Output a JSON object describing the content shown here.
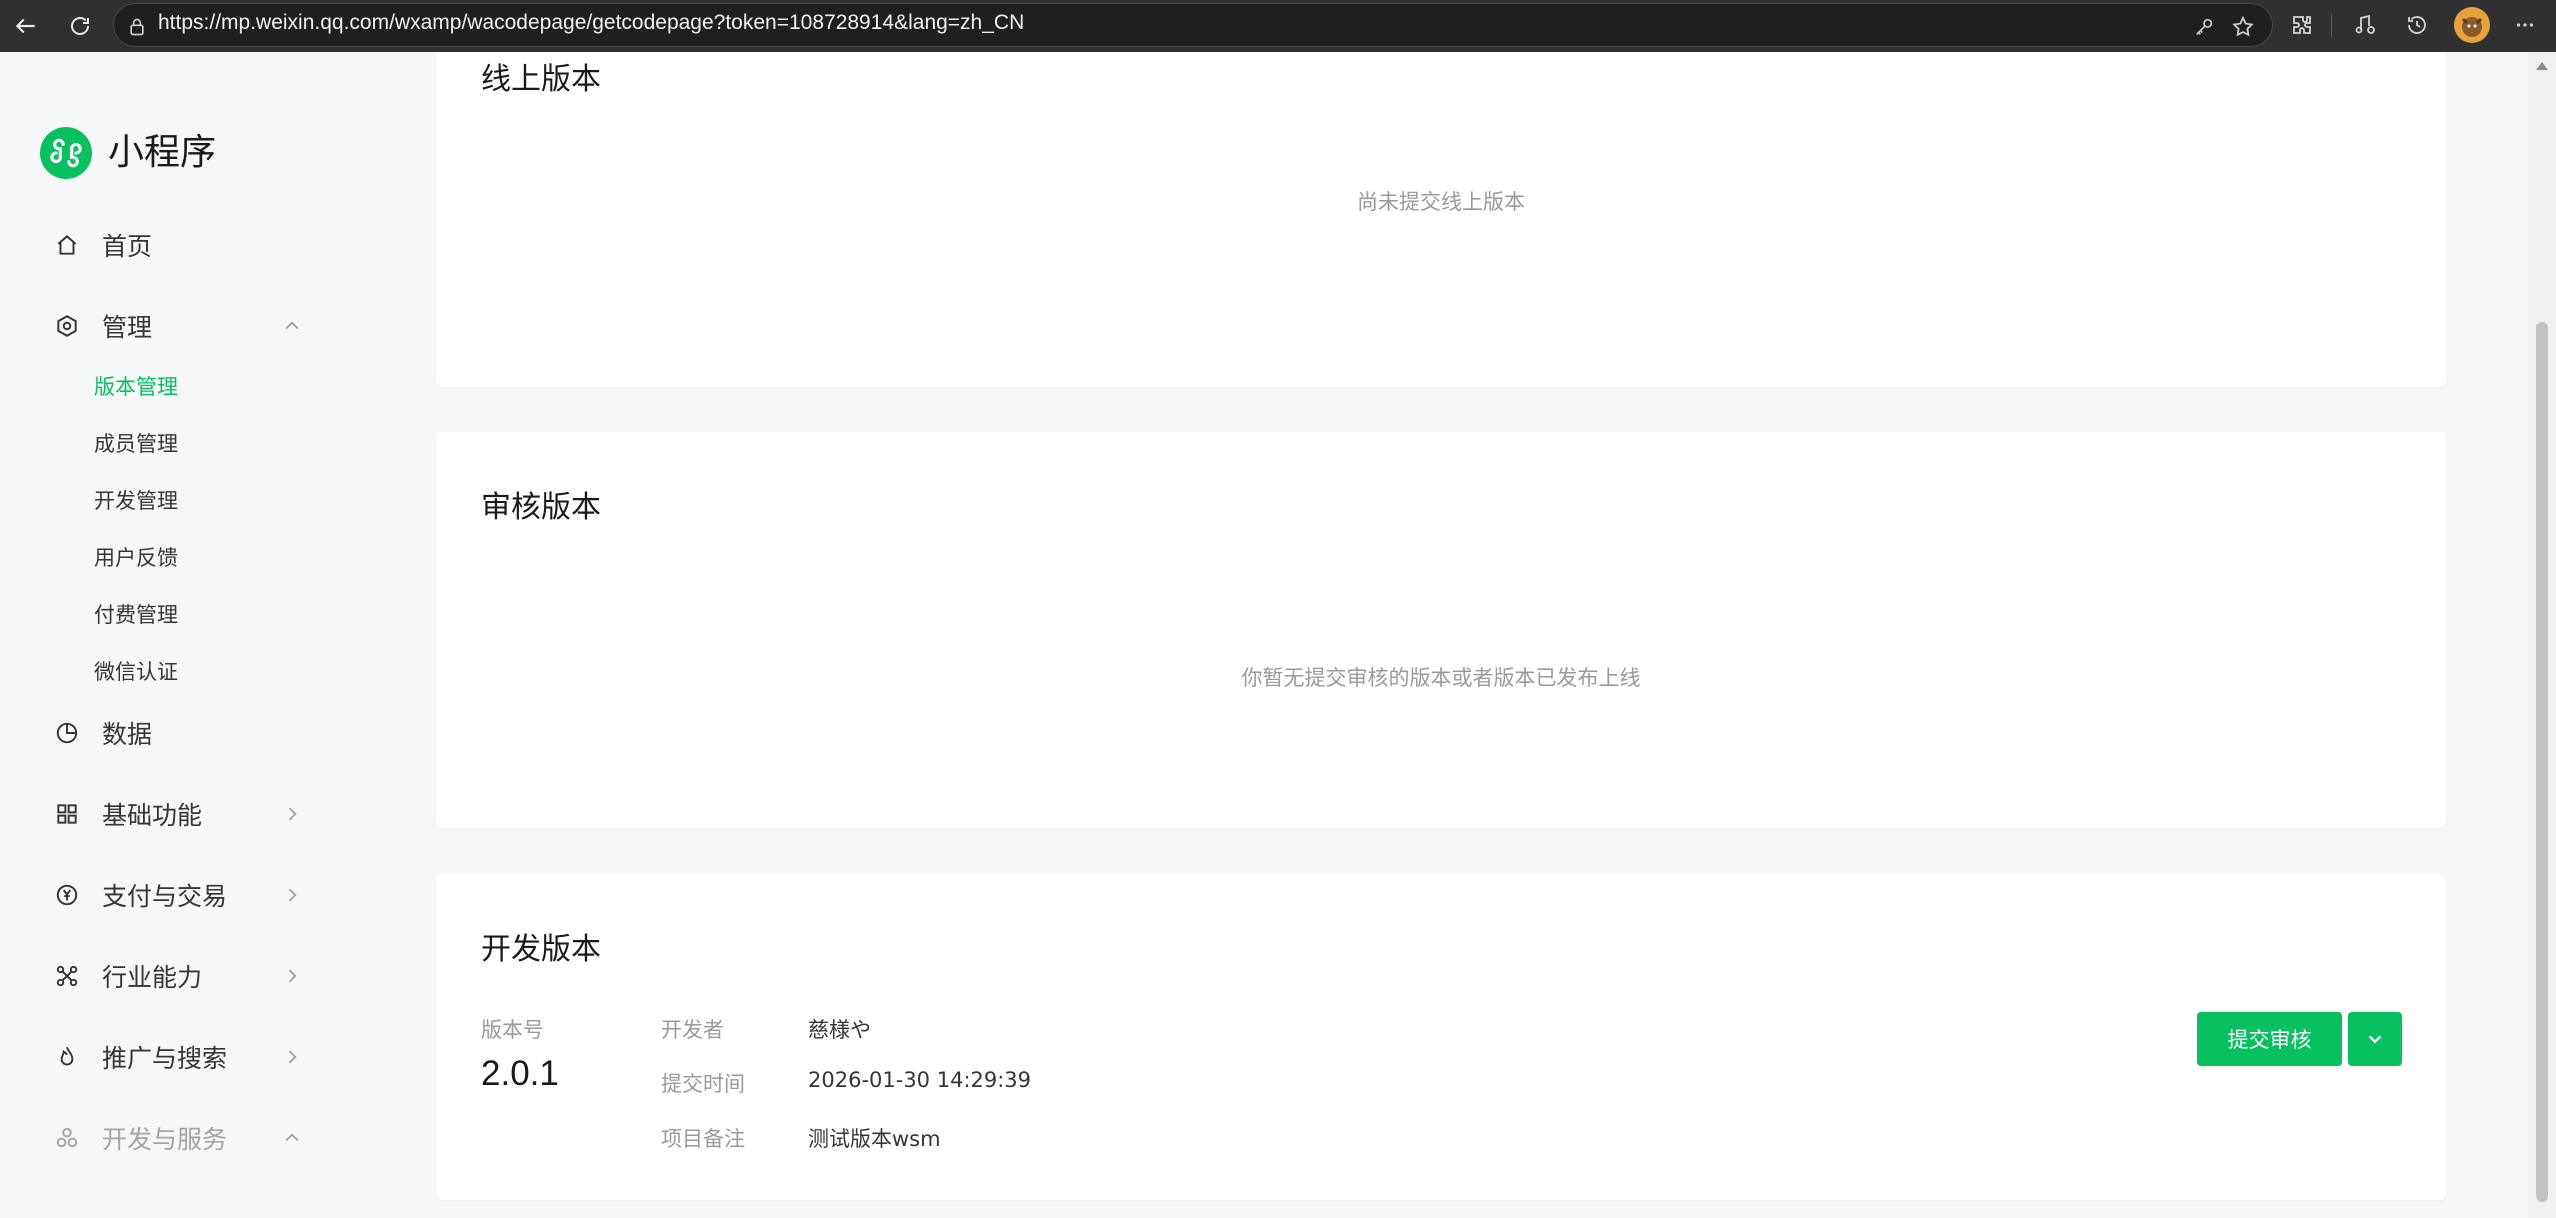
{
  "browser": {
    "url": "https://mp.weixin.qq.com/wxamp/wacodepage/getcodepage?token=108728914&lang=zh_CN"
  },
  "sidebar": {
    "brand": "小程序",
    "items": [
      {
        "label": "首页",
        "icon": "home-icon"
      },
      {
        "label": "管理",
        "icon": "settings-hex-icon",
        "expanded": true,
        "children": [
          "版本管理",
          "成员管理",
          "开发管理",
          "用户反馈",
          "付费管理",
          "微信认证"
        ],
        "active_child": "版本管理"
      },
      {
        "label": "数据",
        "icon": "pie-chart-icon"
      },
      {
        "label": "基础功能",
        "icon": "grid-icon"
      },
      {
        "label": "支付与交易",
        "icon": "yen-icon"
      },
      {
        "label": "行业能力",
        "icon": "network-icon"
      },
      {
        "label": "推广与搜索",
        "icon": "flame-icon"
      },
      {
        "label": "开发与服务",
        "icon": "dev-service-icon"
      }
    ]
  },
  "cards": {
    "online": {
      "title": "线上版本",
      "empty": "尚未提交线上版本"
    },
    "review": {
      "title": "审核版本",
      "empty": "你暂无提交审核的版本或者版本已发布上线"
    },
    "dev": {
      "title": "开发版本",
      "version_label": "版本号",
      "version": "2.0.1",
      "developer_label": "开发者",
      "developer": "慈様や",
      "submit_time_label": "提交时间",
      "submit_time": "2026-01-30 14:29:39",
      "note_label": "项目备注",
      "note": "测试版本wsm",
      "submit_button": "提交审核"
    }
  },
  "colors": {
    "accent": "#07c160"
  }
}
